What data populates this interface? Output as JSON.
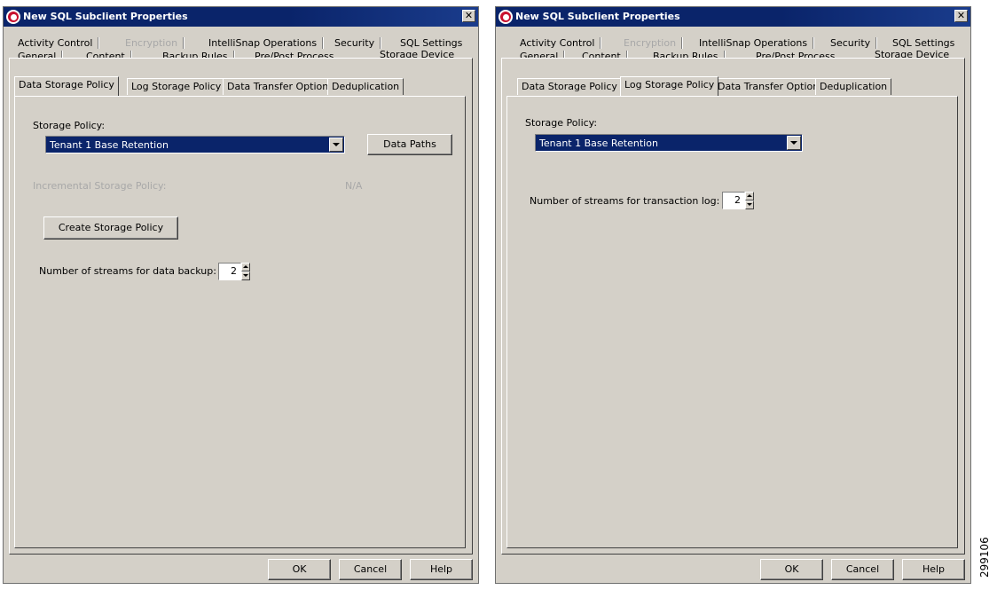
{
  "dialogs": [
    {
      "title": "New SQL Subclient Properties",
      "close_glyph": "✕",
      "tabs_row1": [
        "Activity Control",
        "Encryption",
        "IntelliSnap Operations",
        "Security",
        "SQL Settings"
      ],
      "tabs_row2": [
        "General",
        "Content",
        "Backup Rules",
        "Pre/Post Process",
        "Storage Device"
      ],
      "selected_outer_tab": "Storage Device",
      "inner_tabs": [
        "Data Storage Policy",
        "Log Storage Policy",
        "Data Transfer Option",
        "Deduplication"
      ],
      "selected_inner_tab": "Data Storage Policy",
      "storage_policy_label": "Storage Policy:",
      "storage_policy_value": "Tenant 1 Base Retention",
      "data_paths_button": "Data Paths",
      "incremental_label": "Incremental Storage Policy:",
      "incremental_value": "N/A",
      "create_button": "Create Storage Policy",
      "streams_label": "Number of streams for data backup:",
      "streams_value": "2",
      "buttons": {
        "ok": "OK",
        "cancel": "Cancel",
        "help": "Help"
      }
    },
    {
      "title": "New SQL Subclient Properties",
      "close_glyph": "✕",
      "tabs_row1": [
        "Activity Control",
        "Encryption",
        "IntelliSnap Operations",
        "Security",
        "SQL Settings"
      ],
      "tabs_row2": [
        "General",
        "Content",
        "Backup Rules",
        "Pre/Post Process",
        "Storage Device"
      ],
      "selected_outer_tab": "Storage Device",
      "inner_tabs": [
        "Data Storage Policy",
        "Log Storage Policy",
        "Data Transfer Option",
        "Deduplication"
      ],
      "selected_inner_tab": "Log Storage Policy",
      "storage_policy_label": "Storage Policy:",
      "storage_policy_value": "Tenant 1 Base Retention",
      "streams_label": "Number of streams for transaction log:",
      "streams_value": "2",
      "buttons": {
        "ok": "OK",
        "cancel": "Cancel",
        "help": "Help"
      }
    }
  ],
  "figure_id": "299106",
  "colors": {
    "titlebar": "#0a246a",
    "selection": "#0a246a",
    "dialog_bg": "#d4d0c8"
  }
}
